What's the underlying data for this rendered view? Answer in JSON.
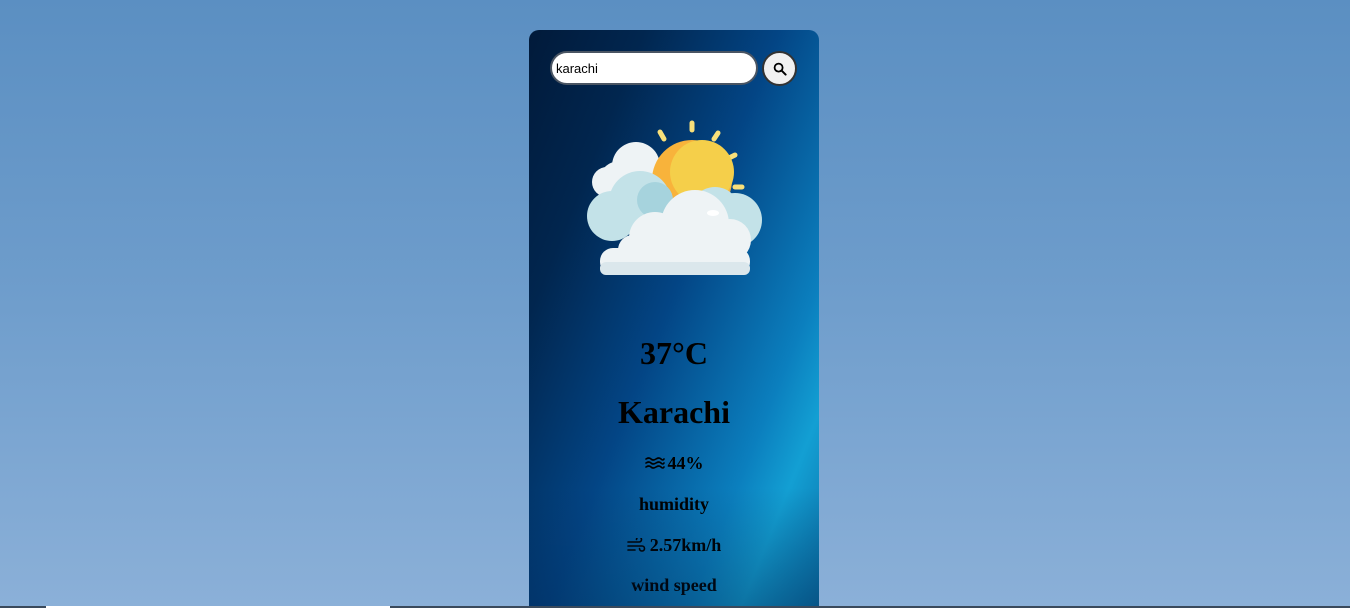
{
  "search": {
    "value": "karachi",
    "button_icon": "search-icon"
  },
  "weather": {
    "icon": "partly-cloudy-sun-icon",
    "temperature": "37°C",
    "city": "Karachi",
    "humidity": {
      "icon": "humidity-waves-icon",
      "value": "44%",
      "label": "humidity"
    },
    "wind": {
      "icon": "wind-icon",
      "value": "2.57km/h",
      "label": "wind speed"
    }
  },
  "colors": {
    "page_background": "#6d9ccb",
    "card_dark": "#011a3a",
    "card_light": "#139fd3",
    "text": "#000000"
  }
}
